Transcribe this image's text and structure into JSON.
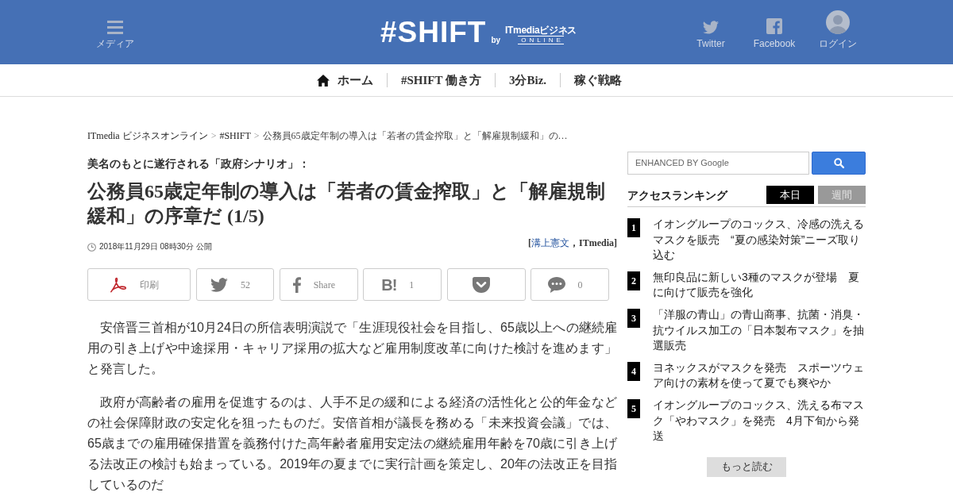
{
  "header": {
    "menu": {
      "label": "メディア"
    },
    "logo": {
      "name": "#SHIFT",
      "by": "by",
      "brand": "ITmediaビジネス",
      "edition": "ONLINE"
    },
    "links": [
      {
        "kind": "twitter",
        "label": "Twitter"
      },
      {
        "kind": "facebook",
        "label": "Facebook"
      },
      {
        "kind": "login",
        "label": "ログイン"
      }
    ]
  },
  "nav": [
    {
      "kind": "home",
      "label": "ホーム"
    },
    {
      "kind": "text",
      "label": "#SHIFT 働き方"
    },
    {
      "kind": "text",
      "label": "3分Biz."
    },
    {
      "kind": "text",
      "label": "稼ぐ戦略"
    }
  ],
  "breadcrumb": [
    {
      "kind": "link",
      "label": "ITmedia ビジネスオンライン"
    },
    {
      "kind": "separator",
      "label": ">"
    },
    {
      "kind": "link",
      "label": "#SHIFT"
    },
    {
      "kind": "separator",
      "label": ">"
    },
    {
      "kind": "current",
      "label": "公務員65歳定年制の導入は「若者の賃金搾取」と「解雇規制緩和」の…"
    }
  ],
  "article": {
    "kicker": "美名のもとに遂行される「政府シナリオ」：",
    "title": "公務員65歳定年制の導入は「若者の賃金搾取」と「解雇規制緩和」の序章だ (1/5)",
    "date": "2018年11月29日 08時30分 公開",
    "byline": {
      "before": "[",
      "author": "溝上憲文",
      "after": "，ITmedia]"
    },
    "share": [
      {
        "kind": "print",
        "label": "印刷"
      },
      {
        "kind": "twitter",
        "label": "52"
      },
      {
        "kind": "facebook",
        "label": "Share"
      },
      {
        "kind": "hatena",
        "icon": "B!",
        "label": "1"
      },
      {
        "kind": "pocket"
      },
      {
        "kind": "comment",
        "label": "0"
      }
    ],
    "paragraphs": [
      "安倍晋三首相が10月24日の所信表明演説で「生涯現役社会を目指し、65歳以上への継続雇用の引き上げや中途採用・キャリア採用の拡大など雇用制度改革に向けた検討を進めます」と発言した。",
      "政府が高齢者の雇用を促進するのは、人手不足の緩和による経済の活性化と公的年金などの社会保障財政の安定化を狙ったものだ。安倍首相が議長を務める「未来投資会議」では、65歳までの雇用確保措置を義務付けた高年齢者雇用安定法の継続雇用年齢を70歳に引き上げる法改正の検討も始まっている。2019年の夏までに実行計画を策定し、20年の法改正を目指しているのだ"
    ]
  },
  "sidebar": {
    "search": {
      "placeholder": "ENHANCED BY Google"
    },
    "ranking": {
      "title": "アクセスランキング",
      "tabs": [
        {
          "label": "本日",
          "selected": true
        },
        {
          "label": "週間",
          "selected": false
        }
      ],
      "items": [
        {
          "rank": "1",
          "title": "イオングループのコックス、冷感の洗えるマスクを販売　“夏の感染対策”ニーズ取り込む"
        },
        {
          "rank": "2",
          "title": "無印良品に新しい3種のマスクが登場　夏に向けて販売を強化"
        },
        {
          "rank": "3",
          "title": "「洋服の青山」の青山商事、抗菌・消臭・抗ウイルス加工の「日本製布マスク」を抽選販売"
        },
        {
          "rank": "4",
          "title": "ヨネックスがマスクを発売　スポーツウェア向けの素材を使って夏でも爽やか"
        },
        {
          "rank": "5",
          "title": "イオングループのコックス、洗える布マスク「やわマスク」を発売　4月下旬から発送"
        }
      ],
      "more": "もっと読む"
    }
  }
}
